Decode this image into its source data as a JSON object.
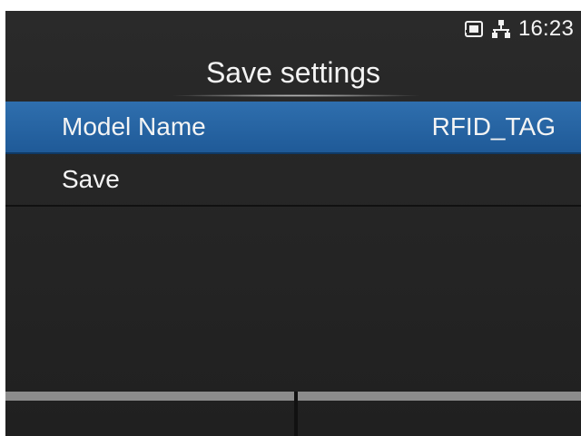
{
  "status": {
    "time": "16:23",
    "icons": [
      "memory-card-icon",
      "network-icon"
    ]
  },
  "title": "Save settings",
  "menu": {
    "items": [
      {
        "label": "Model Name",
        "value": "RFID_TAG",
        "selected": true
      },
      {
        "label": "Save",
        "value": "",
        "selected": false
      }
    ]
  },
  "colors": {
    "selected_row": "#2466a6",
    "background": "#262626",
    "softkey_bar": "#8c8c8c"
  }
}
